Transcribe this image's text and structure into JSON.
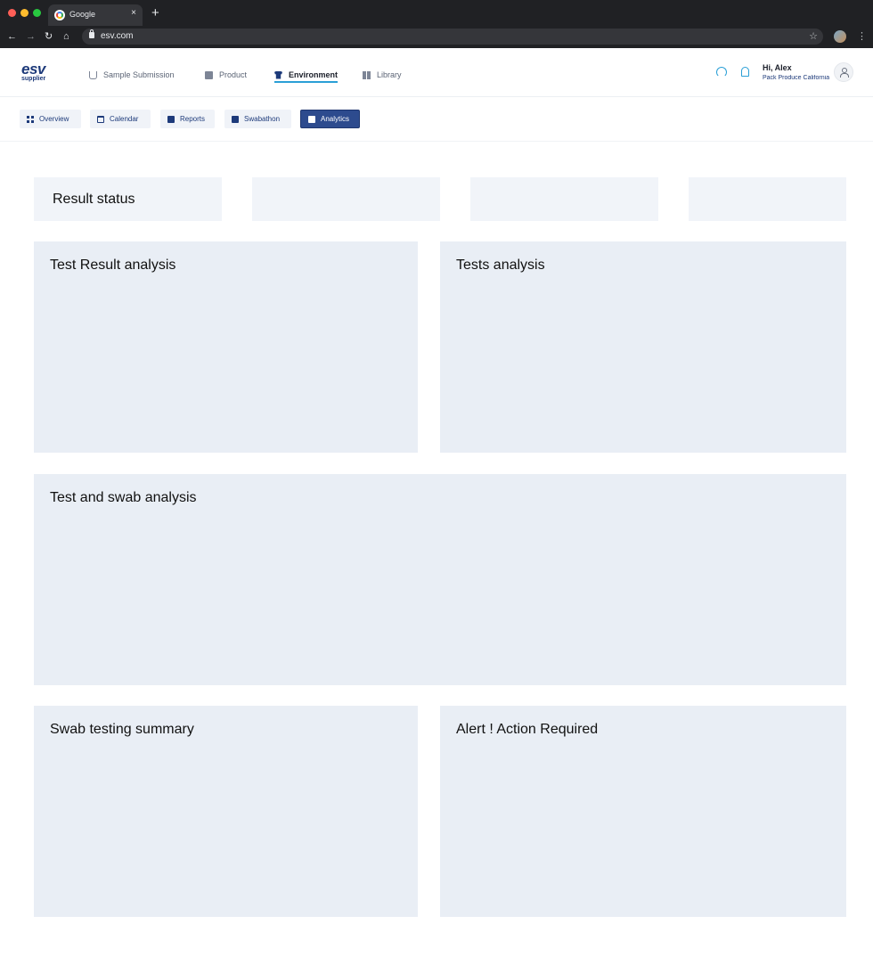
{
  "browser": {
    "tab_title": "Google",
    "tab_close": "×",
    "new_tab": "+",
    "url": "esv.com",
    "back": "←",
    "forward": "→",
    "reload": "↻",
    "home": "⌂",
    "star": "☆",
    "menu": "⋮"
  },
  "logo": {
    "main": "esv",
    "sub": "supplier"
  },
  "main_nav": [
    {
      "label": "Sample Submission",
      "icon": "flask-icon"
    },
    {
      "label": "Product",
      "icon": "box-icon"
    },
    {
      "label": "Environment",
      "icon": "shirt-icon",
      "active": true
    },
    {
      "label": "Library",
      "icon": "library-icon"
    }
  ],
  "user": {
    "greeting": "Hi, Alex",
    "org": "Pack Produce California"
  },
  "sub_nav": [
    {
      "label": "Overview",
      "icon": "grid-icon"
    },
    {
      "label": "Calendar",
      "icon": "calendar-icon"
    },
    {
      "label": "Reports",
      "icon": "clipboard-icon"
    },
    {
      "label": "Swabathon",
      "icon": "clipboard-icon"
    },
    {
      "label": "Analytics",
      "icon": "document-icon",
      "active": true
    }
  ],
  "cards": {
    "result_status": "Result status",
    "test_result_analysis": "Test Result analysis",
    "tests_analysis": "Tests analysis",
    "test_swab_analysis": "Test and swab analysis",
    "swab_testing_summary": "Swab testing summary",
    "alert_action": "Alert ! Action Required"
  },
  "colors": {
    "brand": "#1d3a7a",
    "accent": "#2a9fd6",
    "active_tab": "#2d4b8e",
    "panel_bg": "#e9eef5"
  }
}
